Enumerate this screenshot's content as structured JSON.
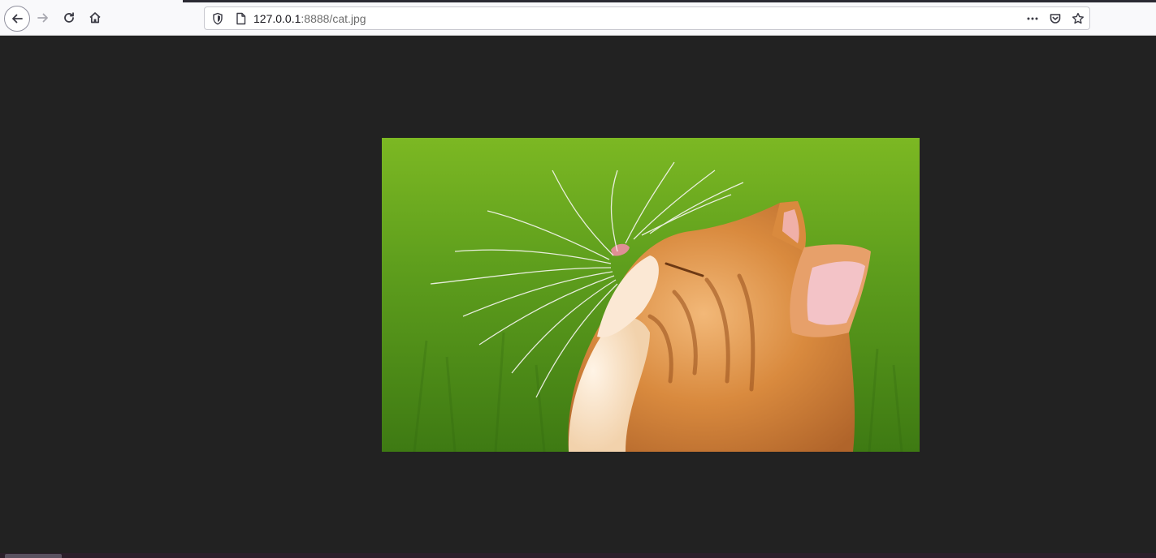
{
  "browser": {
    "url_host": "127.0.0.1",
    "url_rest": ":8888/cat.jpg",
    "icons": {
      "back": "back-arrow-icon",
      "forward": "forward-arrow-icon",
      "reload": "reload-icon",
      "home": "home-icon",
      "shield": "tracking-shield-icon",
      "page": "page-icon",
      "more": "more-icon",
      "pocket": "pocket-icon",
      "bookmark": "bookmark-star-icon"
    }
  },
  "content": {
    "image_alt": "cat.jpg",
    "background_color": "#222222"
  }
}
